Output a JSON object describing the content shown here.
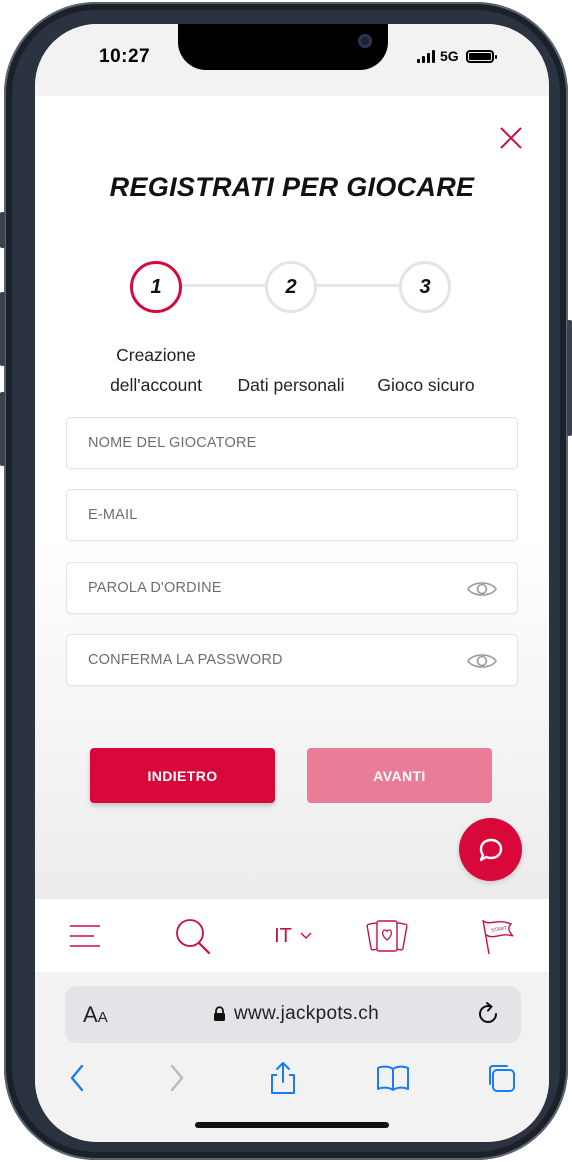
{
  "status_bar": {
    "time": "10:27",
    "network": "5G"
  },
  "modal": {
    "title": "REGISTRATI PER GIOCARE",
    "steps": [
      {
        "number": "1",
        "label_line1": "Creazione",
        "label_line2": "dell'account",
        "active": true
      },
      {
        "number": "2",
        "label": "Dati personali",
        "active": false
      },
      {
        "number": "3",
        "label": "Gioco sicuro",
        "active": false
      }
    ],
    "fields": {
      "player_name_placeholder": "NOME DEL GIOCATORE",
      "email_placeholder": "E-MAIL",
      "password_placeholder": "PAROLA D'ORDINE",
      "confirm_password_placeholder": "CONFERMA LA PASSWORD"
    },
    "buttons": {
      "back_label": "INDIETRO",
      "next_label": "AVANTI"
    }
  },
  "site_nav": {
    "items": [
      "menu-icon",
      "search-icon",
      "language-selector",
      "cards-icon",
      "start-flag-icon"
    ],
    "language": "IT"
  },
  "browser": {
    "aa_large": "A",
    "aa_small": "A",
    "url": "www.jackpots.ch"
  },
  "colors": {
    "accent": "#d9083a",
    "accent_disabled": "#e97c96",
    "ios_blue": "#1a7cf5"
  }
}
